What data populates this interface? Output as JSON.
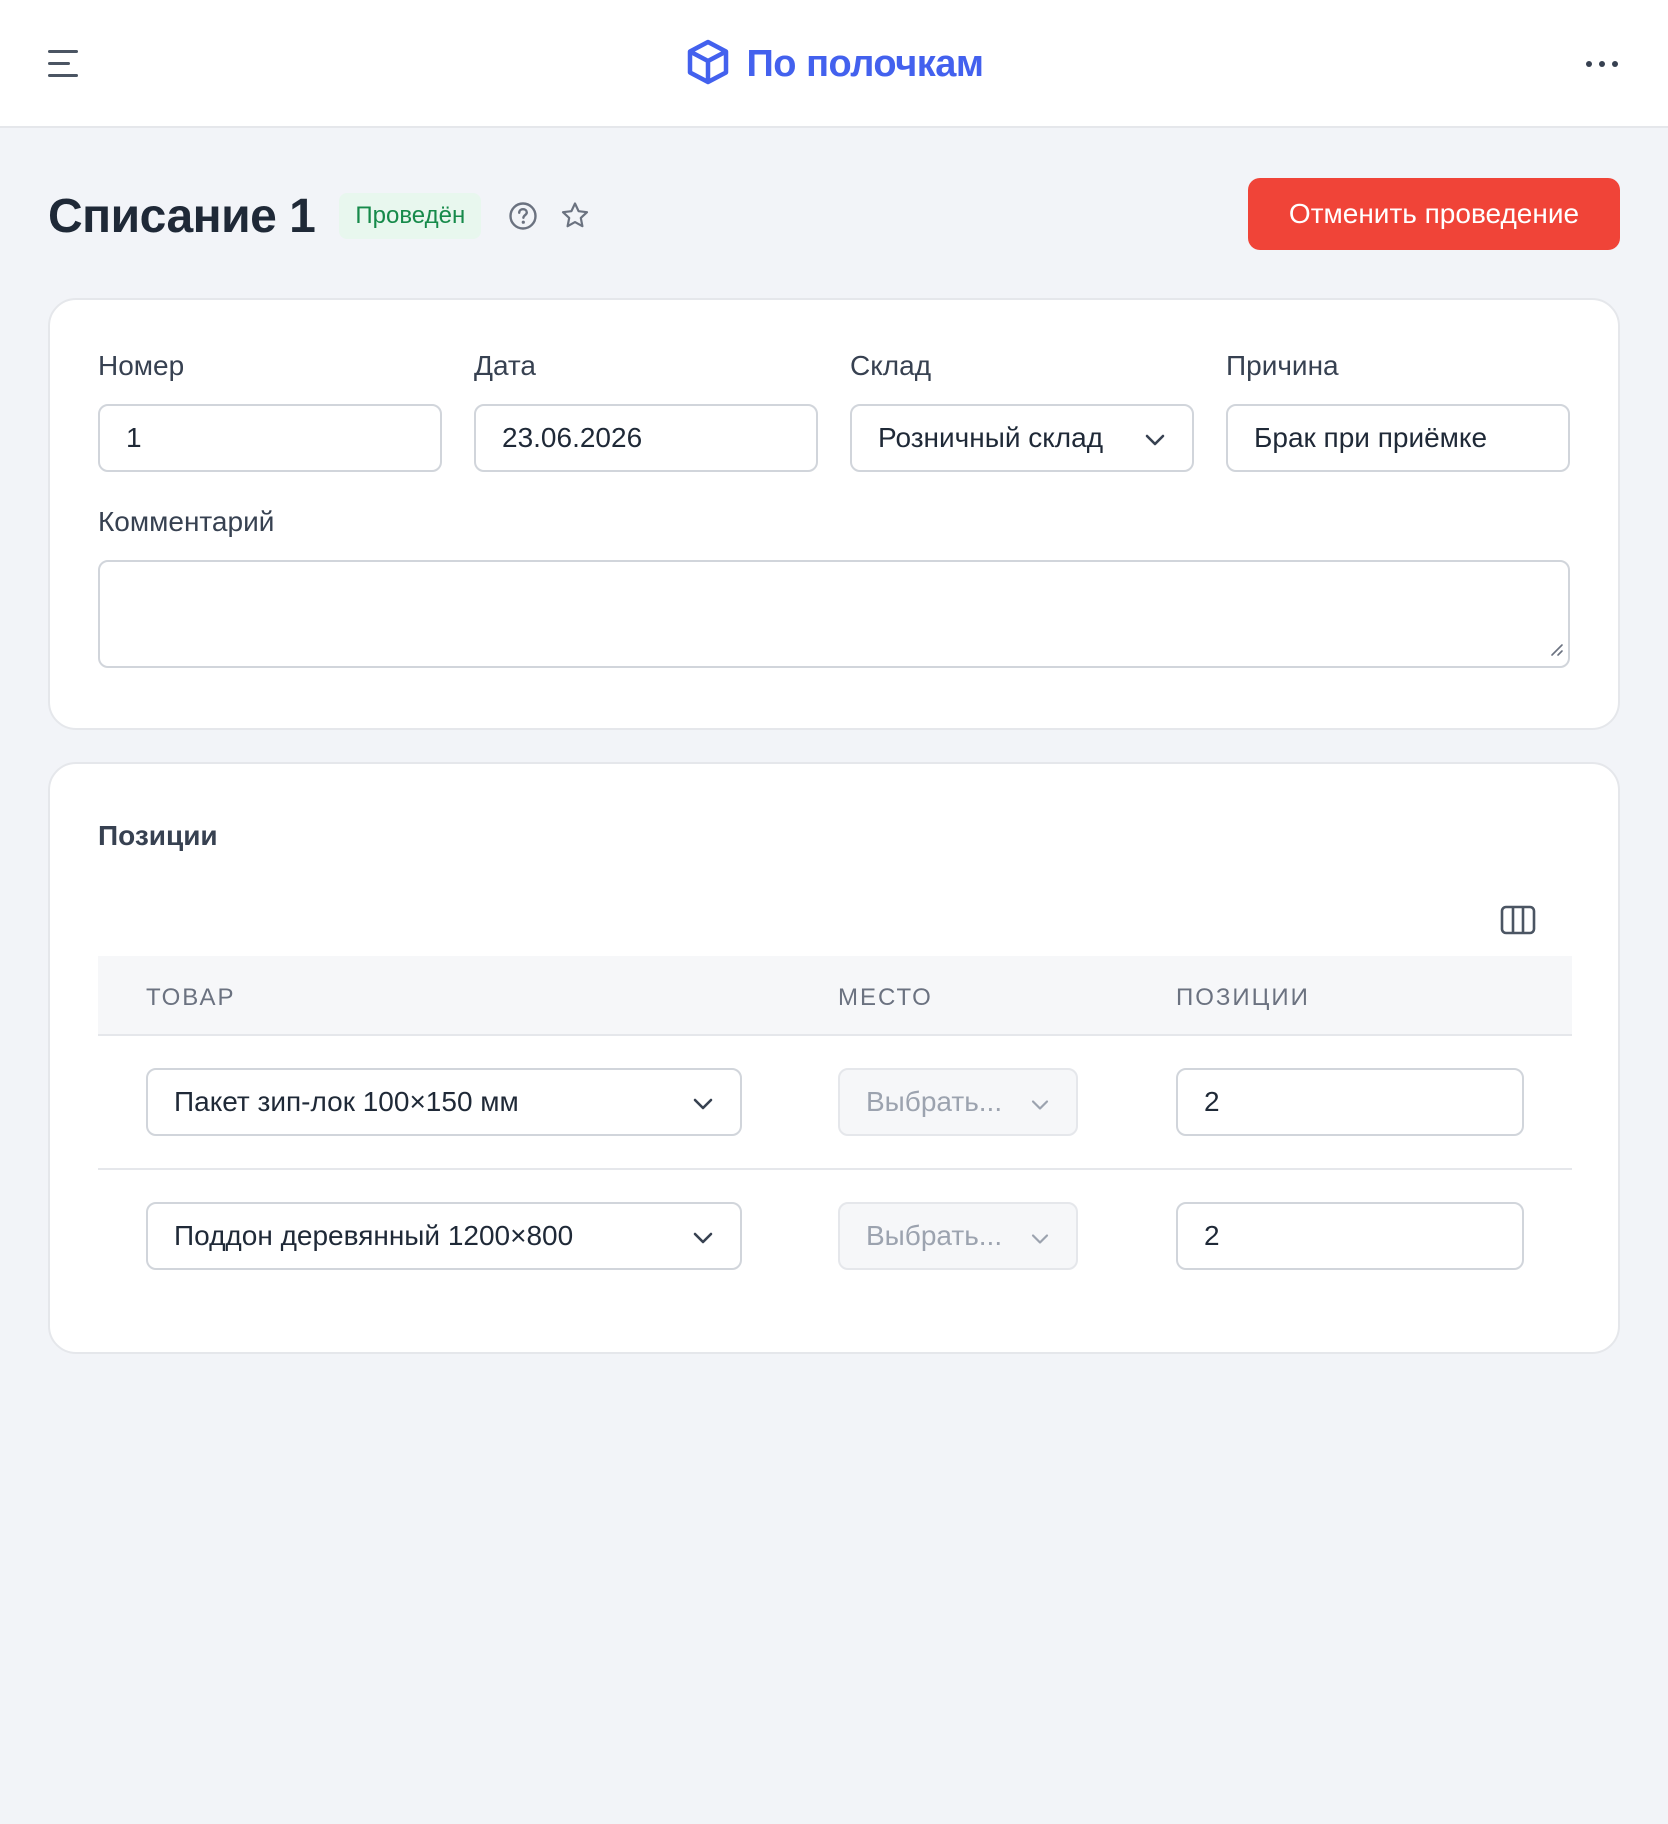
{
  "header": {
    "app_name": "По полочкам",
    "menu_icon": "hamburger-menu-icon",
    "logo_icon": "cube-icon",
    "more_icon": "more-horizontal-icon",
    "brand_color": "#4361ee"
  },
  "page": {
    "title": "Списание 1",
    "status": "Проведён",
    "status_color": "#168a4a",
    "help_icon": "question-circle-icon",
    "favorite_icon": "star-icon",
    "cancel_label": "Отменить проведение",
    "cancel_color": "#f04438"
  },
  "form": {
    "number_label": "Номер",
    "number_value": "1",
    "date_label": "Дата",
    "date_value": "23.06.2026",
    "warehouse_label": "Склад",
    "warehouse_value": "Розничный склад",
    "reason_label": "Причина",
    "reason_value": "Брак при приёмке",
    "comment_label": "Комментарий",
    "comment_value": ""
  },
  "items": {
    "section_title": "Позиции",
    "columns_icon": "columns-icon",
    "headers": [
      "ТОВАР",
      "МЕСТО",
      "ПОЗИЦИИ"
    ],
    "rows": [
      {
        "product": "Пакет зип-лок 100×150 мм",
        "place_placeholder": "Выбрать...",
        "quantity": "2"
      },
      {
        "product": "Поддон деревянный 1200×800",
        "place_placeholder": "Выбрать...",
        "quantity": "2"
      }
    ]
  }
}
